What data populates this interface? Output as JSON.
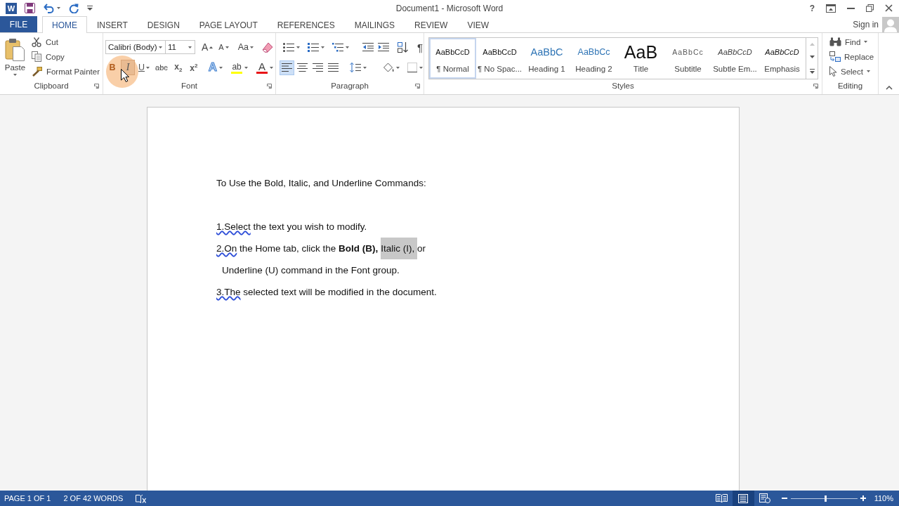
{
  "title_bar": {
    "app_logo": "W",
    "title": "Document1 - Microsoft Word",
    "help": "?"
  },
  "tabs": [
    {
      "label": "FILE",
      "kind": "file",
      "selected": false
    },
    {
      "label": "HOME",
      "kind": "tab",
      "selected": true
    },
    {
      "label": "INSERT",
      "kind": "tab",
      "selected": false
    },
    {
      "label": "DESIGN",
      "kind": "tab",
      "selected": false
    },
    {
      "label": "PAGE LAYOUT",
      "kind": "tab",
      "selected": false
    },
    {
      "label": "REFERENCES",
      "kind": "tab",
      "selected": false
    },
    {
      "label": "MAILINGS",
      "kind": "tab",
      "selected": false
    },
    {
      "label": "REVIEW",
      "kind": "tab",
      "selected": false
    },
    {
      "label": "VIEW",
      "kind": "tab",
      "selected": false
    }
  ],
  "account": {
    "label": "Sign in"
  },
  "ribbon": {
    "clipboard": {
      "paste": "Paste",
      "commands": [
        {
          "kind": "cut",
          "label": "Cut"
        },
        {
          "kind": "copy",
          "label": "Copy"
        },
        {
          "kind": "format_painter",
          "label": "Format Painter"
        }
      ],
      "label": "Clipboard"
    },
    "font": {
      "font_name": "Calibri (Body)",
      "font_size": "11",
      "size_buttons": [
        {
          "kind": "grow",
          "glyph": "A"
        },
        {
          "kind": "shrink",
          "glyph": "A"
        },
        {
          "kind": "case",
          "glyph": "Aa"
        }
      ],
      "format_buttons": [
        {
          "kind": "bold",
          "glyph": "B",
          "hovered": false
        },
        {
          "kind": "italic",
          "glyph": "I",
          "hovered": true
        },
        {
          "kind": "underline",
          "glyph": "U",
          "hovered": false
        },
        {
          "kind": "strikethrough",
          "glyph": "abc",
          "hovered": false
        },
        {
          "kind": "subscript",
          "glyph": "x$_{2}$",
          "hovered": false
        },
        {
          "kind": "superscript",
          "glyph": "x$^{2}$",
          "hovered": false
        }
      ],
      "color_buttons": [
        {
          "kind": "effects",
          "glyph": "A"
        },
        {
          "kind": "highlight",
          "glyph": "ab",
          "color": "#ffff00"
        },
        {
          "kind": "font_color",
          "glyph": "A",
          "color": "#e81416"
        }
      ],
      "label": "Font"
    },
    "paragraph": {
      "pilcrow": "¶",
      "alignment": [
        {
          "kind": "left",
          "selected": true
        },
        {
          "kind": "center",
          "selected": false
        },
        {
          "kind": "right",
          "selected": false
        },
        {
          "kind": "justify",
          "selected": false
        }
      ],
      "label": "Paragraph"
    },
    "styles": {
      "items": [
        {
          "kind": "normal",
          "preview": "AaBbCcD",
          "name": "¶ Normal",
          "selected": true
        },
        {
          "kind": "normal",
          "preview": "AaBbCcD",
          "name": "¶ No Spac...",
          "selected": false
        },
        {
          "kind": "heading1",
          "preview": "AaBbC",
          "name": "Heading 1",
          "selected": false
        },
        {
          "kind": "heading2",
          "preview": "AaBbCc",
          "name": "Heading 2",
          "selected": false
        },
        {
          "kind": "title",
          "preview": "AaB",
          "name": "Title",
          "selected": false
        },
        {
          "kind": "subtitle",
          "preview": "AaBbCc",
          "name": "Subtitle",
          "selected": false
        },
        {
          "kind": "subtle_emphasis",
          "preview": "AaBbCcD",
          "name": "Subtle Em...",
          "selected": false
        },
        {
          "kind": "emphasis",
          "preview": "AaBbCcD",
          "name": "Emphasis",
          "selected": false
        }
      ],
      "label": "Styles"
    },
    "editing": {
      "commands": [
        {
          "kind": "find",
          "label": "Find",
          "dropdown": true
        },
        {
          "kind": "replace",
          "label": "Replace",
          "dropdown": false
        },
        {
          "kind": "select",
          "label": "Select",
          "dropdown": true
        }
      ],
      "label": "Editing"
    }
  },
  "document": {
    "paragraphs": [
      {
        "kind": "title",
        "segments": [
          {
            "text": "To Use the Bold, Italic, and Underline Commands:",
            "flagged": false,
            "selected": false
          }
        ]
      },
      {
        "kind": "step",
        "segments": [
          {
            "text": "1.Select",
            "flagged": true,
            "selected": false
          },
          {
            "text": " the text you wish to modify.",
            "flagged": false,
            "selected": false
          }
        ]
      },
      {
        "kind": "step",
        "segments": [
          {
            "text": "2.On",
            "flagged": true,
            "selected": false
          },
          {
            "text": " the Home tab, click the **Bold (B),** ",
            "flagged": false,
            "selected": false
          },
          {
            "text": "Italic (I), ",
            "flagged": false,
            "selected": true
          },
          {
            "text": "or",
            "flagged": false,
            "selected": false
          }
        ]
      },
      {
        "kind": "continuation",
        "segments": [
          {
            "text": "Underline (U) command in the Font group.",
            "flagged": false,
            "selected": false
          }
        ]
      },
      {
        "kind": "step",
        "segments": [
          {
            "text": "3.The",
            "flagged": true,
            "selected": false
          },
          {
            "text": " selected text will be modified in the document.",
            "flagged": false,
            "selected": false
          }
        ]
      }
    ]
  },
  "status_bar": {
    "page": "PAGE 1 OF 1",
    "words": "2 OF 42 WORDS",
    "views": [
      {
        "kind": "read",
        "selected": false
      },
      {
        "kind": "print",
        "selected": true
      },
      {
        "kind": "web",
        "selected": false
      }
    ],
    "zoom": {
      "level": 0.52,
      "reading": "110%"
    }
  }
}
